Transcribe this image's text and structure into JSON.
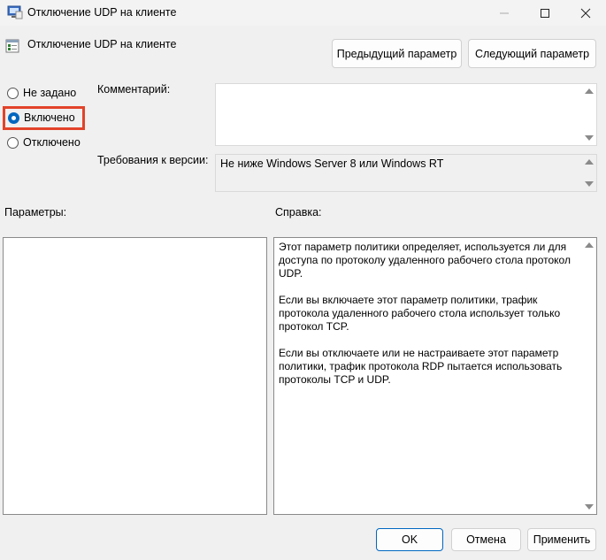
{
  "window": {
    "title": "Отключение UDP на клиенте"
  },
  "header": {
    "policy_name": "Отключение UDP на клиенте",
    "prev_button": "Предыдущий параметр",
    "next_button": "Следующий параметр"
  },
  "state_options": [
    {
      "label": "Не задано",
      "checked": false
    },
    {
      "label": "Включено",
      "checked": true
    },
    {
      "label": "Отключено",
      "checked": false
    }
  ],
  "comment": {
    "label": "Комментарий:",
    "value": ""
  },
  "supported_on": {
    "label": "Требования к версии:",
    "value": "Не ниже Windows Server 8 или Windows RT"
  },
  "options_section": {
    "label": "Параметры:"
  },
  "help_section": {
    "label": "Справка:",
    "paragraphs": [
      "Этот параметр политики определяет, используется ли для доступа по протоколу удаленного рабочего стола протокол UDP.",
      "Если вы включаете этот параметр политики, трафик протокола удаленного рабочего стола использует только протокол TCP.",
      "Если вы отключаете или не настраиваете этот параметр политики, трафик протокола RDP пытается использовать протоколы TCP и UDP."
    ]
  },
  "footer": {
    "ok": "OK",
    "cancel": "Отмена",
    "apply": "Применить"
  },
  "colors": {
    "highlight": "#e2432a",
    "accent": "#0067c0"
  }
}
